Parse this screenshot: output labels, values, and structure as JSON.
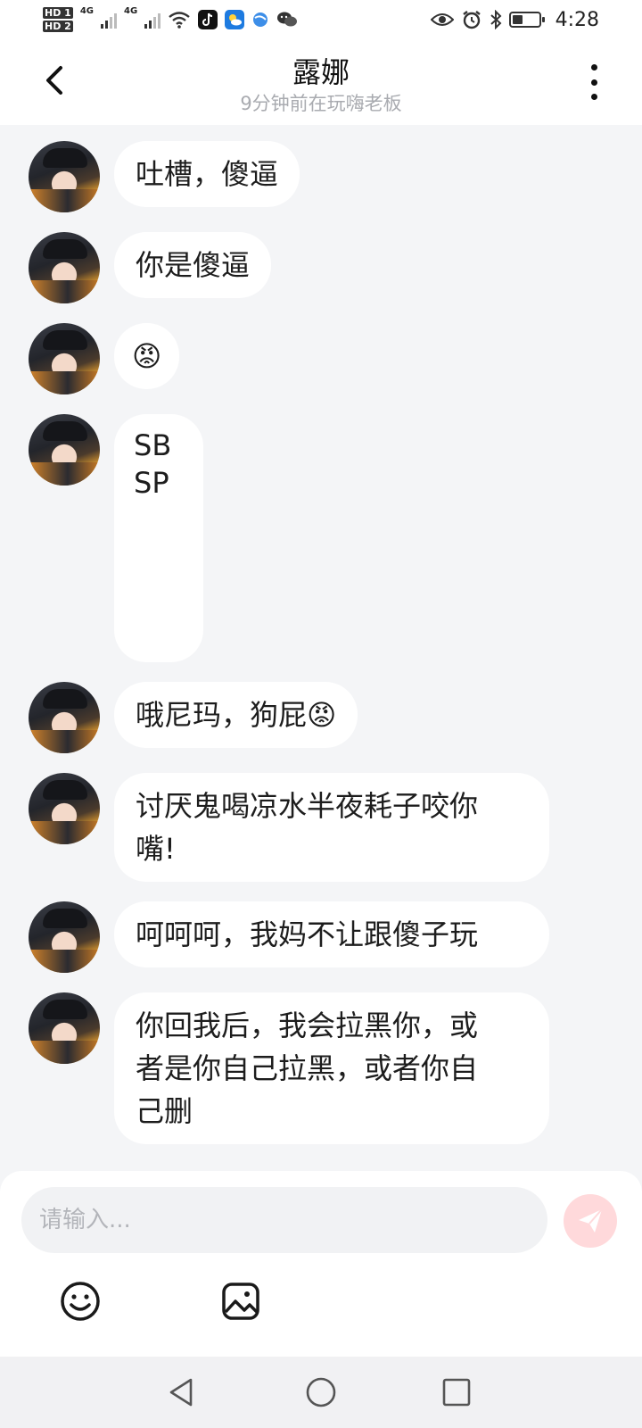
{
  "status_bar": {
    "sim1": "HD 1",
    "sim2": "HD 2",
    "net1": "4G",
    "net2": "4G",
    "time": "4:28",
    "icons": [
      "signal-icon",
      "wifi-icon",
      "tiktok-icon",
      "weather-icon",
      "browser-icon",
      "wechat-icon",
      "eye-icon",
      "alarm-icon",
      "bluetooth-icon",
      "battery-icon"
    ],
    "battery_level": 0.4
  },
  "header": {
    "title": "露娜",
    "subtitle": "9分钟前在玩嗨老板"
  },
  "messages": [
    {
      "text": "吐槽，傻逼"
    },
    {
      "text": "你是傻逼"
    },
    {
      "text": "😡"
    },
    {
      "text": "SB\nSP"
    },
    {
      "text": "哦尼玛，狗屁😡"
    },
    {
      "text": "讨厌鬼喝凉水半夜耗子咬你\n嘴!"
    },
    {
      "text": "呵呵呵，我妈不让跟傻子玩"
    },
    {
      "text": "你回我后，我会拉黑你，或\n者是你自己拉黑，或者你自\n己删"
    }
  ],
  "input": {
    "placeholder": "请输入..."
  },
  "colors": {
    "background": "#f4f5f7",
    "bubble": "#ffffff",
    "send_button": "#ffd9db",
    "subtitle": "#a9abb0"
  }
}
